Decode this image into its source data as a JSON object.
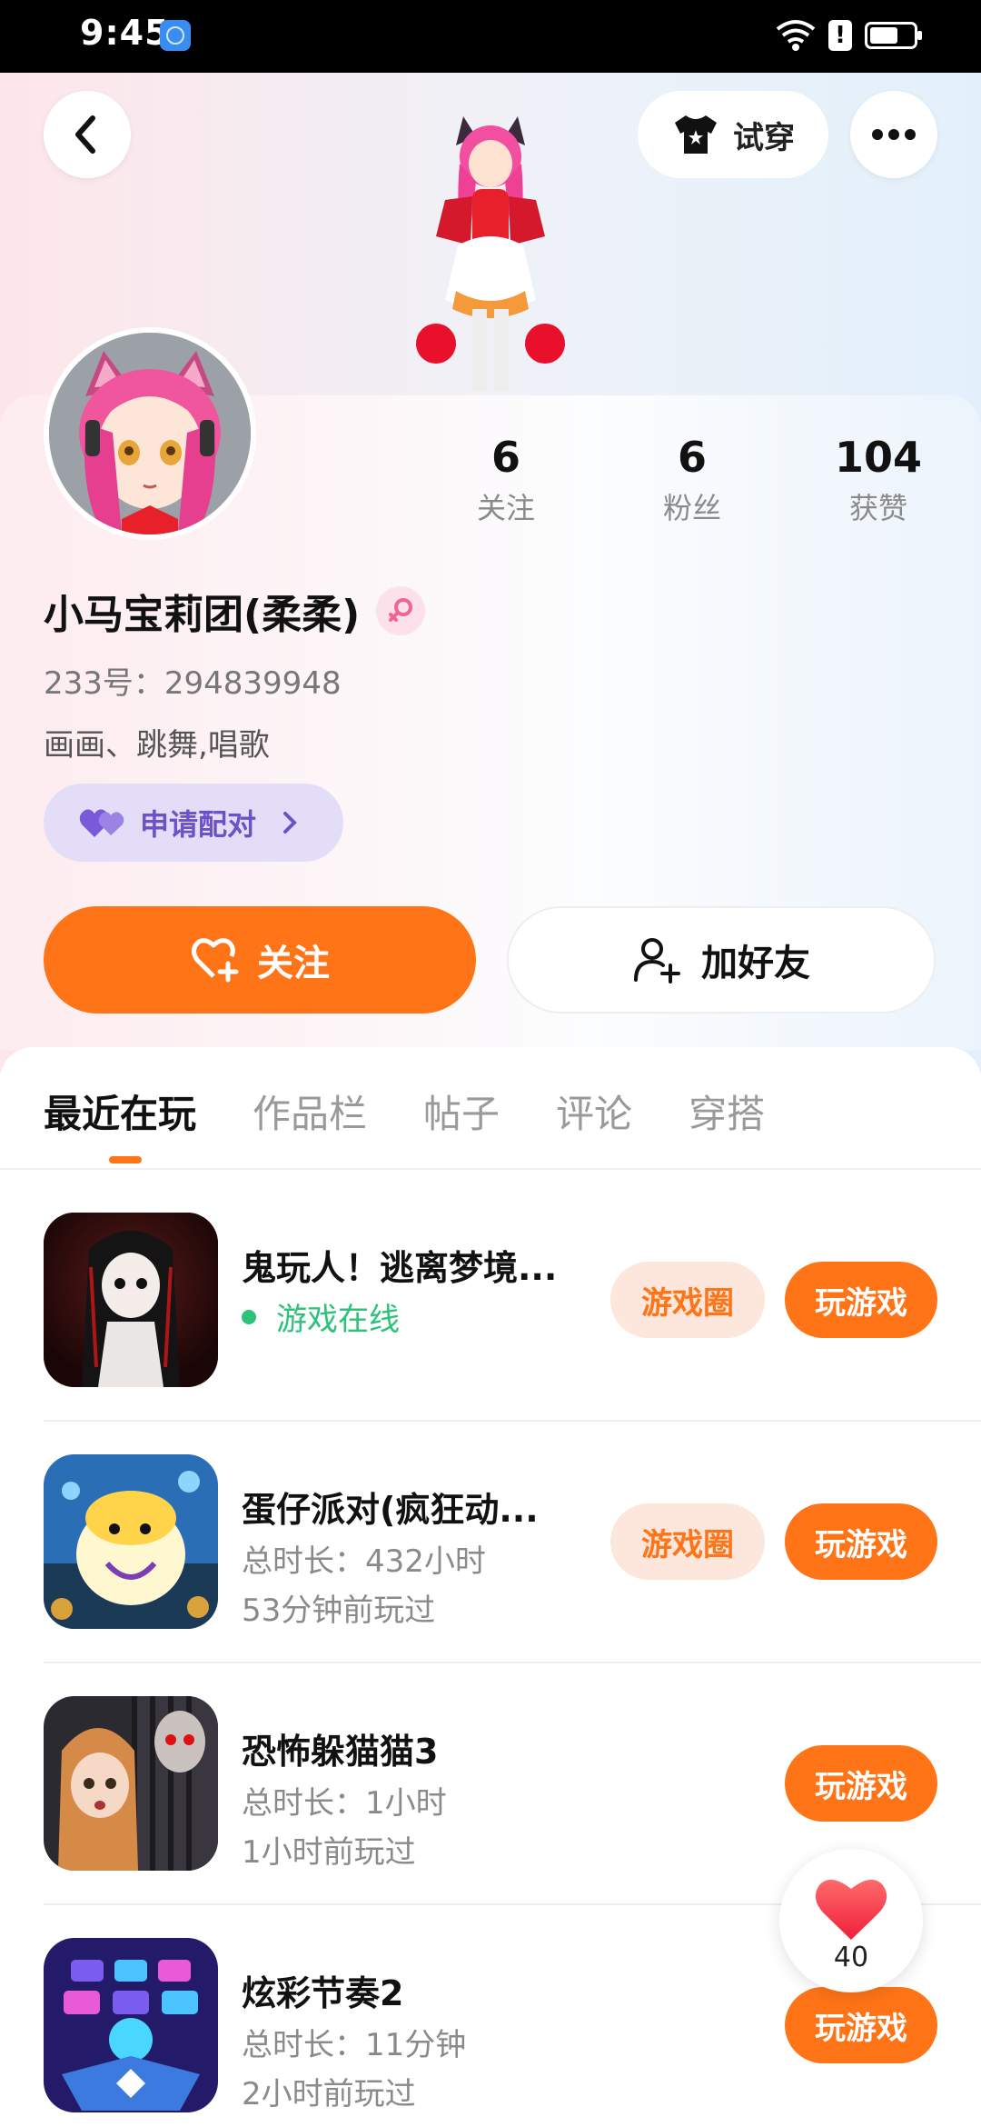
{
  "status_bar": {
    "time": "9:45"
  },
  "header": {
    "tryon_label": "试穿"
  },
  "profile": {
    "name": "小马宝莉团(柔柔)",
    "id_line": "233号：294839948",
    "bio": "画画、跳舞,唱歌",
    "pair_label": "申请配对"
  },
  "stats": [
    {
      "value": "6",
      "label": "关注"
    },
    {
      "value": "6",
      "label": "粉丝"
    },
    {
      "value": "104",
      "label": "获赞"
    }
  ],
  "actions": {
    "follow": "关注",
    "add_friend": "加好友"
  },
  "tabs": [
    {
      "label": "最近在玩",
      "active": true
    },
    {
      "label": "作品栏",
      "active": false
    },
    {
      "label": "帖子",
      "active": false
    },
    {
      "label": "评论",
      "active": false
    },
    {
      "label": "穿搭",
      "active": false
    }
  ],
  "games": [
    {
      "title": "鬼玩人！逃离梦境...",
      "status": "游戏在线",
      "has_circle": true,
      "circle_label": "游戏圈",
      "play_label": "玩游戏"
    },
    {
      "title": "蛋仔派对(疯狂动...",
      "duration": "总时长：432小时",
      "last_played": "53分钟前玩过",
      "has_circle": true,
      "circle_label": "游戏圈",
      "play_label": "玩游戏"
    },
    {
      "title": "恐怖躲猫猫3",
      "duration": "总时长：1小时",
      "last_played": "1小时前玩过",
      "has_circle": false,
      "play_label": "玩游戏"
    },
    {
      "title": "炫彩节奏2",
      "duration": "总时长：11分钟",
      "last_played": "2小时前玩过",
      "has_circle": false,
      "play_label": "玩游戏"
    }
  ],
  "like_fab": {
    "count": "40"
  },
  "colors": {
    "accent": "#ff7417",
    "online": "#2cc27a",
    "pair": "#6b52c8"
  }
}
